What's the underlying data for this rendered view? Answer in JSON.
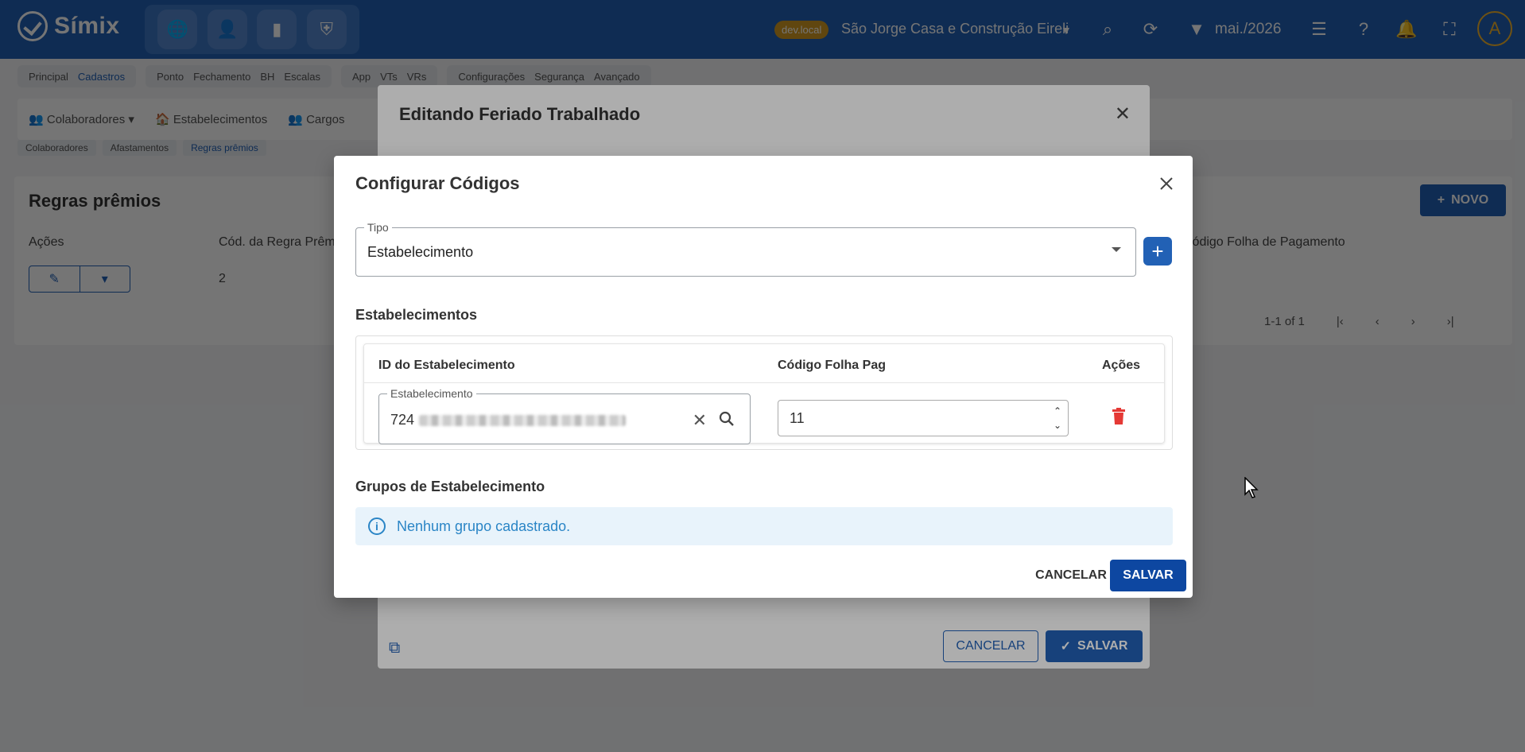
{
  "app": {
    "name": "Símix"
  },
  "topbar": {
    "env_badge": "dev.local",
    "company": "São Jorge Casa e Construção Eireli",
    "period": "mai./2026",
    "avatar_initial": "A"
  },
  "menu": {
    "groups": [
      [
        "Principal",
        "Cadastros"
      ],
      [
        "Ponto",
        "Fechamento",
        "BH",
        "Escalas"
      ],
      [
        "App",
        "VTs",
        "VRs"
      ],
      [
        "Configurações",
        "Segurança",
        "Avançado"
      ]
    ],
    "active": "Cadastros"
  },
  "subnav": {
    "items": [
      "Colaboradores",
      "Estabelecimentos",
      "Cargos"
    ]
  },
  "breadcrumbs": [
    "Colaboradores",
    "Afastamentos",
    "Regras prêmios"
  ],
  "panel": {
    "title": "Regras prêmios",
    "col_acoes": "Ações",
    "col_cod": "Cód. da Regra Prêmio",
    "col_folha": "Código Folha de Pagamento",
    "row_value": "2",
    "novo": "NOVO",
    "pagination": "1-1 of 1"
  },
  "dialog_back": {
    "title": "Editando Feriado Trabalhado",
    "cancel": "CANCELAR",
    "save": "SALVAR"
  },
  "dialog": {
    "title": "Configurar Códigos",
    "tipo_label": "Tipo",
    "tipo_value": "Estabelecimento",
    "section_estab": "Estabelecimentos",
    "col_id": "ID do Estabelecimento",
    "col_codigo": "Código Folha Pag",
    "col_acoes": "Ações",
    "estab_label": "Estabelecimento",
    "estab_value": "724",
    "codigo_value": "11",
    "section_grupos": "Grupos de Estabelecimento",
    "info": "Nenhum grupo cadastrado.",
    "cancel": "CANCELAR",
    "save": "SALVAR"
  },
  "colors": {
    "primary": "#2261b5",
    "save": "#0d47a1",
    "danger": "#e53935",
    "info": "#2a85c6",
    "badge": "#d29a23"
  }
}
